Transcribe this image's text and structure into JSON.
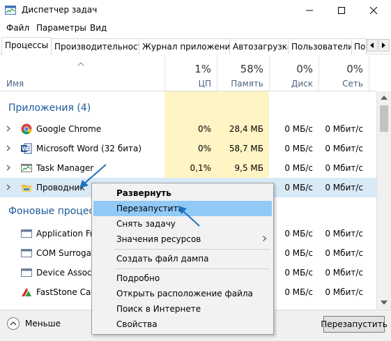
{
  "window": {
    "title": "Диспетчер задач"
  },
  "menu": [
    "Файл",
    "Параметры",
    "Вид"
  ],
  "tabs": [
    "Процессы",
    "Производительность",
    "Журнал приложений",
    "Автозагрузка",
    "Пользователи",
    "По"
  ],
  "header": {
    "name_label": "Имя",
    "cpu": {
      "pct": "1%",
      "label": "ЦП"
    },
    "mem": {
      "pct": "58%",
      "label": "Память"
    },
    "disk": {
      "pct": "0%",
      "label": "Диск"
    },
    "net": {
      "pct": "0%",
      "label": "Сеть"
    }
  },
  "groups": {
    "apps": "Приложения (4)",
    "background": "Фоновые процессы"
  },
  "rows": [
    {
      "name": "Google Chrome",
      "cpu": "0%",
      "mem": "28,4 МБ",
      "disk": "0 МБ/с",
      "net": "0 Мбит/с",
      "icon": "chrome-icon"
    },
    {
      "name": "Microsoft Word (32 бита)",
      "cpu": "0%",
      "mem": "58,7 МБ",
      "disk": "0 МБ/с",
      "net": "0 Мбит/с",
      "icon": "word-icon"
    },
    {
      "name": "Task Manager",
      "cpu": "0,1%",
      "mem": "9,5 МБ",
      "disk": "0 МБ/с",
      "net": "0 Мбит/с",
      "icon": "task-manager-icon"
    },
    {
      "name": "Проводник",
      "cpu": "",
      "mem": "",
      "disk": "0 МБ/с",
      "net": "0 Мбит/с",
      "icon": "explorer-icon"
    }
  ],
  "bg_rows": [
    {
      "name": "Application Fra",
      "disk": "0 МБ/с",
      "net": "0 Мбит/с",
      "icon": "app-frame-icon"
    },
    {
      "name": "COM Surrogate",
      "disk": "0 МБ/с",
      "net": "0 Мбит/с",
      "icon": "com-surrogate-icon"
    },
    {
      "name": "Device Associat",
      "disk": "0 МБ/с",
      "net": "0 Мбит/с",
      "icon": "device-assoc-icon"
    },
    {
      "name": "FastStone Capt",
      "disk": "0 МБ/с",
      "net": "0 Мбит/с",
      "icon": "faststone-icon"
    }
  ],
  "context_menu": [
    {
      "label": "Развернуть",
      "bold": true
    },
    {
      "label": "Перезапустить",
      "highlight": true
    },
    {
      "label": "Снять задачу"
    },
    {
      "label": "Значения ресурсов",
      "submenu": true
    },
    {
      "label": "Создать файл дампа"
    },
    {
      "label": "Подробно"
    },
    {
      "label": "Открыть расположение файла"
    },
    {
      "label": "Поиск в Интернете"
    },
    {
      "label": "Свойства"
    }
  ],
  "footer": {
    "less_label": "Меньше",
    "restart_label": "Перезапустить"
  },
  "colors": {
    "accent": "#1c5a9a",
    "highlight_column": "#fff4c4",
    "selected_row": "#d9eaf7",
    "menu_highlight": "#91c9f7",
    "annotation_arrow": "#1e73be"
  }
}
